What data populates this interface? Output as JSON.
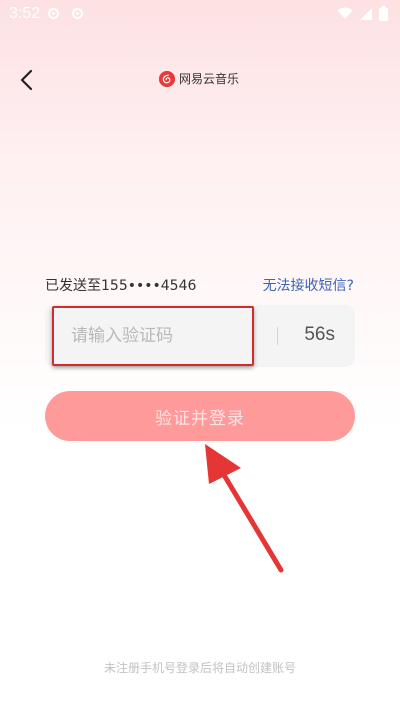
{
  "status_bar": {
    "time": "3:52",
    "icons": [
      "netease-status-icon",
      "netease-status-icon",
      "wifi-icon",
      "signal-icon",
      "battery-icon"
    ]
  },
  "header": {
    "back_icon": "chevron-left-icon",
    "brand_logo": "netease-music-logo",
    "brand_name": "网易云音乐"
  },
  "verification": {
    "sent_to_label": "已发送至155••••4546",
    "no_sms_link": "无法接收短信?",
    "code_placeholder": "请输入验证码",
    "code_value": "",
    "countdown": "56s"
  },
  "login_button_label": "验证并登录",
  "footer_note": "未注册手机号登录后将自动创建账号",
  "colors": {
    "accent": "#ff9a9b",
    "link": "#3a66b5",
    "annotation": "#cc2e2e",
    "brand": "#e83a3a"
  }
}
